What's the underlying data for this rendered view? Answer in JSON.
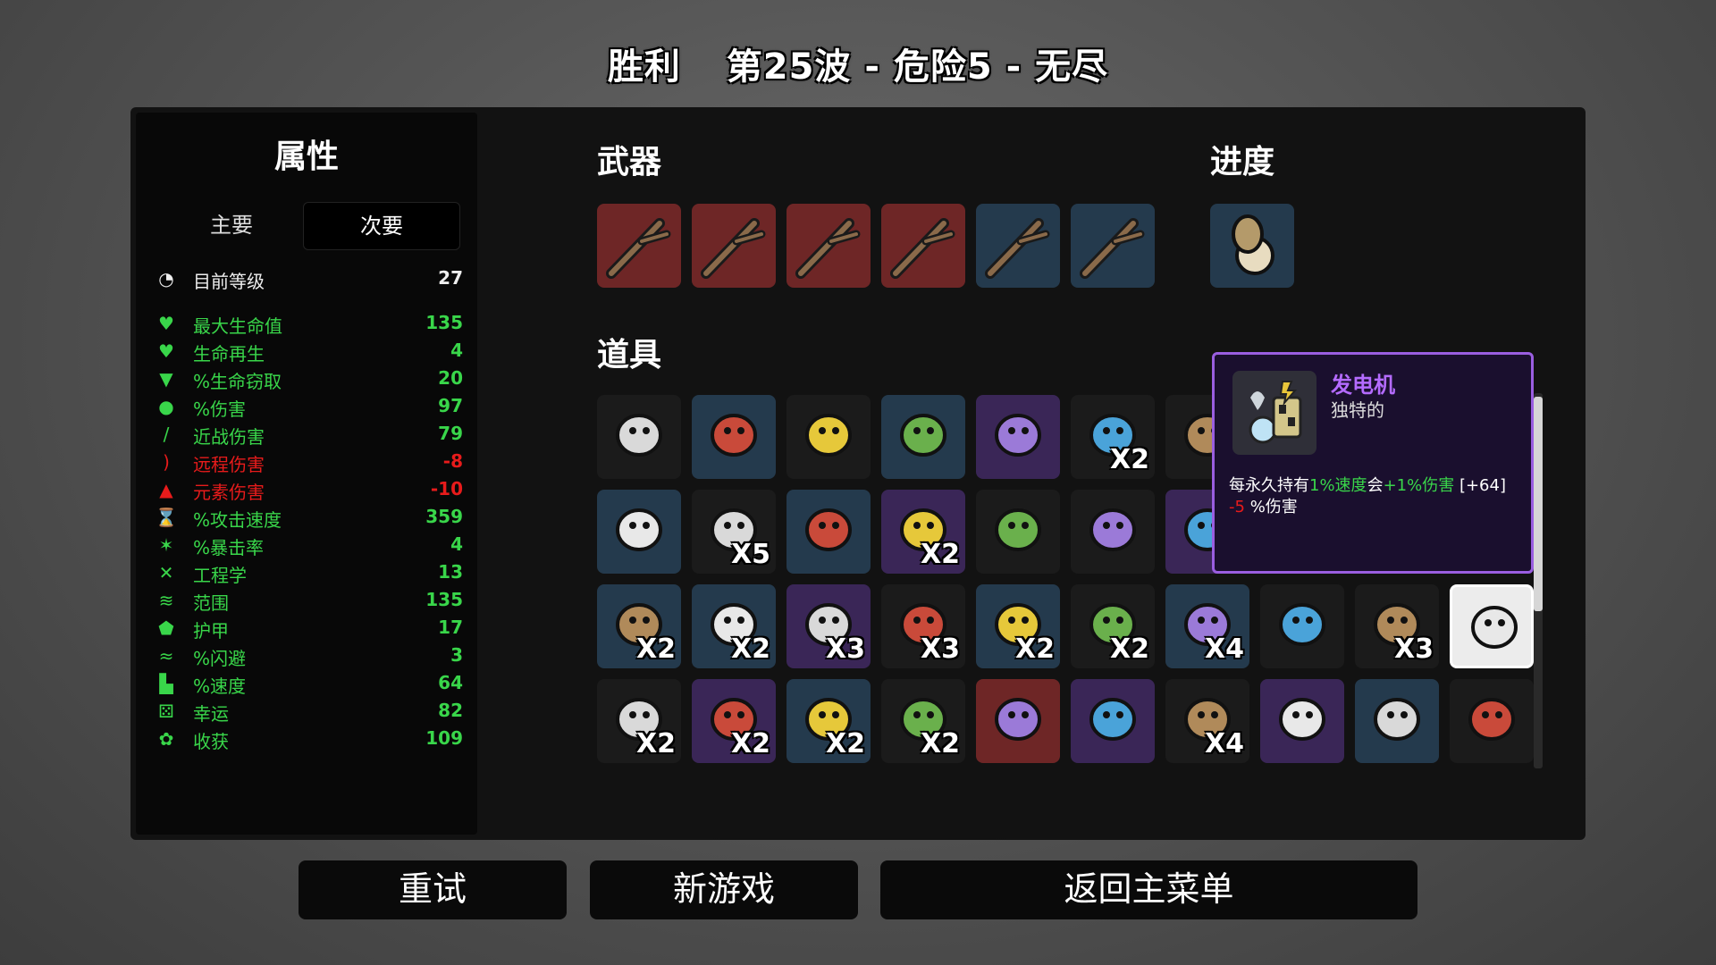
{
  "title": {
    "result": "胜利",
    "wave": "第25波 - 危险5 - 无尽"
  },
  "stats": {
    "heading": "属性",
    "tabs": {
      "primary": "主要",
      "secondary": "次要"
    },
    "level": {
      "name": "目前等级",
      "value": "27"
    },
    "rows": [
      {
        "icon": "heart-icon",
        "name": "最大生命值",
        "value": "135",
        "tone": "green"
      },
      {
        "icon": "heart-regen-icon",
        "name": "生命再生",
        "value": "4",
        "tone": "green"
      },
      {
        "icon": "fangs-icon",
        "name": "%生命窃取",
        "value": "20",
        "tone": "green"
      },
      {
        "icon": "muscle-icon",
        "name": "%伤害",
        "value": "97",
        "tone": "green"
      },
      {
        "icon": "sword-icon",
        "name": "近战伤害",
        "value": "79",
        "tone": "green"
      },
      {
        "icon": "bow-icon",
        "name": "远程伤害",
        "value": "-8",
        "tone": "red"
      },
      {
        "icon": "flame-icon",
        "name": "元素伤害",
        "value": "-10",
        "tone": "red"
      },
      {
        "icon": "hourglass-icon",
        "name": "%攻击速度",
        "value": "359",
        "tone": "green"
      },
      {
        "icon": "crit-star-icon",
        "name": "%暴击率",
        "value": "4",
        "tone": "green"
      },
      {
        "icon": "wrench-icon",
        "name": "工程学",
        "value": "13",
        "tone": "green"
      },
      {
        "icon": "range-wave-icon",
        "name": "范围",
        "value": "135",
        "tone": "green"
      },
      {
        "icon": "shield-icon",
        "name": "护甲",
        "value": "17",
        "tone": "green"
      },
      {
        "icon": "dodge-icon",
        "name": "%闪避",
        "value": "3",
        "tone": "green"
      },
      {
        "icon": "boot-icon",
        "name": "%速度",
        "value": "64",
        "tone": "green"
      },
      {
        "icon": "dice-icon",
        "name": "幸运",
        "value": "82",
        "tone": "green"
      },
      {
        "icon": "wheat-icon",
        "name": "收获",
        "value": "109",
        "tone": "green"
      }
    ]
  },
  "sections": {
    "weapons": "武器",
    "progress": "进度",
    "items": "道具"
  },
  "weapons": [
    {
      "icon": "stick-icon",
      "tier": "red"
    },
    {
      "icon": "stick-icon",
      "tier": "red"
    },
    {
      "icon": "stick-icon",
      "tier": "red"
    },
    {
      "icon": "stick-icon",
      "tier": "red"
    },
    {
      "icon": "stick-icon",
      "tier": "blue"
    },
    {
      "icon": "stick-icon",
      "tier": "blue"
    }
  ],
  "progress_items": [
    {
      "icon": "pocket-watch-icon",
      "tier": "blue"
    }
  ],
  "items": [
    [
      {
        "icon": "bearded-face-icon",
        "tier": "dark",
        "count": ""
      },
      {
        "icon": "black-belt-icon",
        "tier": "blue",
        "count": ""
      },
      {
        "icon": "bat-icon",
        "tier": "dark",
        "count": ""
      },
      {
        "icon": "banner-icon",
        "tier": "blue",
        "count": ""
      },
      {
        "icon": "crown-icon",
        "tier": "purple",
        "count": ""
      },
      {
        "icon": "cake-icon",
        "tier": "dark",
        "count": "X2"
      },
      {
        "icon": "camera-icon",
        "tier": "dark",
        "count": "X"
      }
    ],
    [
      {
        "icon": "cherry-knife-icon",
        "tier": "blue",
        "count": ""
      },
      {
        "icon": "red-snail-icon",
        "tier": "dark",
        "count": "X5"
      },
      {
        "icon": "worm-icon",
        "tier": "blue",
        "count": ""
      },
      {
        "icon": "peacock-icon",
        "tier": "purple",
        "count": "X2"
      },
      {
        "icon": "mushroom-icon",
        "tier": "dark",
        "count": ""
      },
      {
        "icon": "snake-icon",
        "tier": "dark",
        "count": ""
      },
      {
        "icon": "bird-icon",
        "tier": "purple",
        "count": "X"
      }
    ],
    [
      {
        "icon": "larva-icon",
        "tier": "blue",
        "count": "X2"
      },
      {
        "icon": "claw-glove-icon",
        "tier": "blue",
        "count": "X2"
      },
      {
        "icon": "wings-icon",
        "tier": "purple",
        "count": "X3"
      },
      {
        "icon": "duck-icon",
        "tier": "dark",
        "count": "X3"
      },
      {
        "icon": "bullet-icon",
        "tier": "blue",
        "count": "X2"
      },
      {
        "icon": "tongue-icon",
        "tier": "dark",
        "count": "X2"
      },
      {
        "icon": "robot-arm-icon",
        "tier": "blue",
        "count": "X4"
      },
      {
        "icon": "ghost-icon",
        "tier": "dark",
        "count": ""
      },
      {
        "icon": "hedgehog-icon",
        "tier": "dark",
        "count": "X3"
      },
      {
        "icon": "generator-icon",
        "tier": "white",
        "count": ""
      }
    ],
    [
      {
        "icon": "leech-icon",
        "tier": "dark",
        "count": "X2"
      },
      {
        "icon": "skulls-icon",
        "tier": "purple",
        "count": "X2"
      },
      {
        "icon": "horns-icon",
        "tier": "blue",
        "count": "X2"
      },
      {
        "icon": "moss-rock-icon",
        "tier": "dark",
        "count": "X2"
      },
      {
        "icon": "spider-mech-icon",
        "tier": "red",
        "count": ""
      },
      {
        "icon": "helmet-icon",
        "tier": "purple",
        "count": ""
      },
      {
        "icon": "fang-icon",
        "tier": "dark",
        "count": "X4"
      },
      {
        "icon": "eye-drone-icon",
        "tier": "purple",
        "count": ""
      },
      {
        "icon": "jellyfish-icon",
        "tier": "blue",
        "count": ""
      },
      {
        "icon": "butterfly-icon",
        "tier": "dark",
        "count": ""
      }
    ]
  ],
  "tooltip": {
    "icon": "generator-icon",
    "name": "发电机",
    "type": "独特的",
    "line1_a": "每永久持有",
    "line1_b": "1%速度",
    "line1_c": "会",
    "line1_d": "+1%伤害",
    "line1_e": "[+64]",
    "line2_a": "-5",
    "line2_b": "%伤害"
  },
  "buttons": {
    "retry": "重试",
    "new_game": "新游戏",
    "main_menu": "返回主菜单"
  },
  "colors": {
    "positive": "#39d64a",
    "negative": "#e81b1b",
    "tier_red": "#6e2626",
    "tier_blue": "#243a4d",
    "tier_purple": "#3a2657",
    "tooltip_border": "#9a5ee0",
    "tooltip_name": "#b46bff"
  }
}
